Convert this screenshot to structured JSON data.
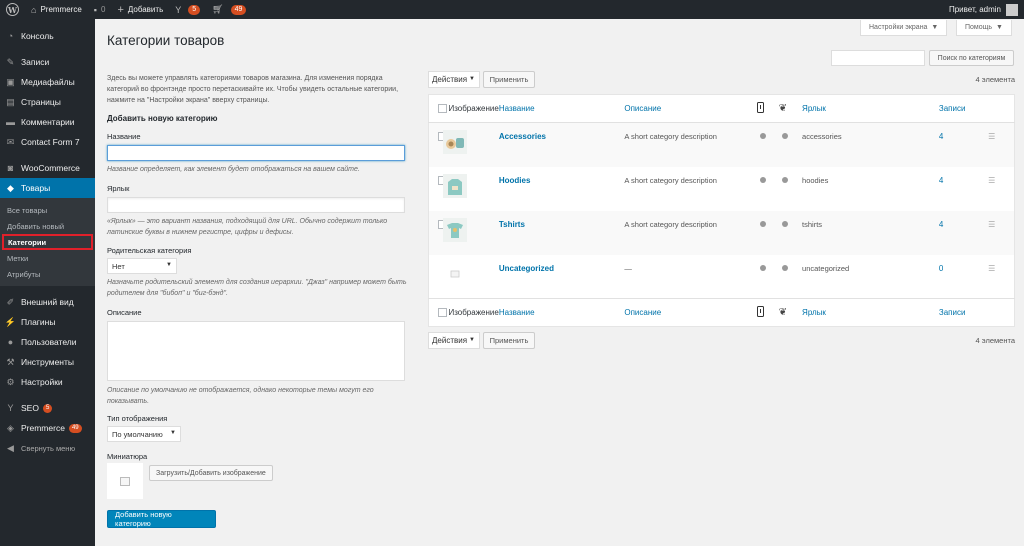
{
  "adminbar": {
    "site_name": "Premmerce",
    "comments_count": "0",
    "new_label": "Добавить",
    "yoast_count": "5",
    "cart_count": "49",
    "greeting": "Привет, admin"
  },
  "sidebar": {
    "items": [
      {
        "label": "Консоль",
        "icon": "dashboard-icon"
      },
      {
        "label": "Записи",
        "icon": "pin-icon"
      },
      {
        "label": "Медиафайлы",
        "icon": "media-icon"
      },
      {
        "label": "Страницы",
        "icon": "page-icon"
      },
      {
        "label": "Комментарии",
        "icon": "comment-icon"
      },
      {
        "label": "Contact Form 7",
        "icon": "mail-icon"
      },
      {
        "label": "WooCommerce",
        "icon": "woo-icon"
      },
      {
        "label": "Товары",
        "icon": "box-icon"
      }
    ],
    "sub_items": [
      "Все товары",
      "Добавить новый",
      "Категории",
      "Метки",
      "Атрибуты"
    ],
    "bottom_items": [
      {
        "label": "Внешний вид",
        "icon": "brush-icon"
      },
      {
        "label": "Плагины",
        "icon": "plugin-icon"
      },
      {
        "label": "Пользователи",
        "icon": "user-icon"
      },
      {
        "label": "Инструменты",
        "icon": "wrench-icon"
      },
      {
        "label": "Настройки",
        "icon": "settings-icon"
      },
      {
        "label": "SEO",
        "icon": "yoast-icon",
        "badge": "5"
      },
      {
        "label": "Premmerce",
        "icon": "premmerce-icon",
        "badge": "49"
      },
      {
        "label": "Свернуть меню",
        "icon": "collapse-icon"
      }
    ]
  },
  "header": {
    "screen_options": "Настройки экрана",
    "help": "Помощь",
    "title": "Категории товаров",
    "search_button": "Поиск по категориям",
    "search_value": ""
  },
  "form": {
    "intro": "Здесь вы можете управлять категориями товаров магазина. Для изменения порядка категорий во фронтэнде просто перетаскивайте их. Чтобы увидеть остальные категории, нажмите на \"Настройки экрана\" вверху страницы.",
    "title": "Добавить новую категорию",
    "name_label": "Название",
    "name_value": "",
    "name_desc": "Название определяет, как элемент будет отображаться на вашем сайте.",
    "slug_label": "Ярлык",
    "slug_value": "",
    "slug_desc": "«Ярлык» — это вариант названия, подходящий для URL. Обычно содержит только латинские буквы в нижнем регистре, цифры и дефисы.",
    "parent_label": "Родительская категория",
    "parent_value": "Нет",
    "parent_desc": "Назначьте родительский элемент для создания иерархии. \"Джаз\" например может быть родителем для \"бибоп\" и \"биг-бэнд\".",
    "description_label": "Описание",
    "description_value": "",
    "description_desc": "Описание по умолчанию не отображается, однако некоторые темы могут его показывать.",
    "display_type_label": "Тип отображения",
    "display_type_value": "По умолчанию",
    "thumbnail_label": "Миниатюра",
    "upload_button": "Загрузить/Добавить изображение",
    "submit_button": "Добавить новую категорию"
  },
  "table": {
    "bulk_action": "Действия",
    "apply": "Применить",
    "items_count": "4 элемента",
    "columns": {
      "image": "Изображение",
      "name": "Название",
      "description": "Описание",
      "slug": "Ярлык",
      "count": "Записи"
    },
    "rows": [
      {
        "name": "Accessories",
        "description": "A short category description",
        "slug": "accessories",
        "count": "4",
        "thumb": "accessories"
      },
      {
        "name": "Hoodies",
        "description": "A short category description",
        "slug": "hoodies",
        "count": "4",
        "thumb": "hoodie"
      },
      {
        "name": "Tshirts",
        "description": "A short category description",
        "slug": "tshirts",
        "count": "4",
        "thumb": "tshirt"
      },
      {
        "name": "Uncategorized",
        "description": "—",
        "slug": "uncategorized",
        "count": "0",
        "thumb": "placeholder"
      }
    ]
  },
  "colors": {
    "sidebar_bg": "#23282d",
    "accent": "#0073aa",
    "highlight_border": "#e0202a",
    "badge": "#d54e21"
  }
}
